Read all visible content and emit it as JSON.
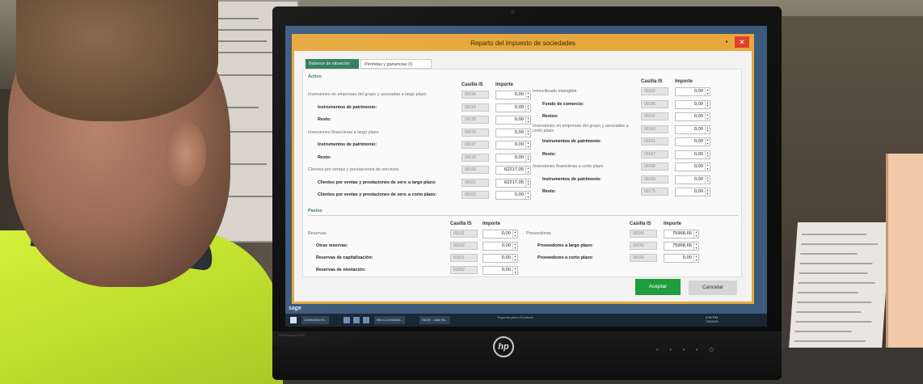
{
  "window": {
    "title": "Reparto del impuesto de sociedades",
    "close_glyph": "✕",
    "minimize_glyph": "▪"
  },
  "tabs": [
    {
      "label": "Balance de situación"
    },
    {
      "label": "Pérdidas y ganancias (I)"
    }
  ],
  "activo": {
    "section_title": "Activo",
    "header_casilla": "Casilla IS",
    "header_importe": "Importe",
    "left_rows": [
      {
        "label": "Inversiones en empresas del grupo y asociadas a largo plazo",
        "casilla": "00118",
        "importe": "0,00"
      },
      {
        "label": "Instrumentos de patrimonio:",
        "casilla": "00119",
        "importe": "0,00"
      },
      {
        "label": "Resto:",
        "casilla": "00125",
        "importe": "0,00"
      },
      {
        "label": "Inversiones financieras a largo plazo",
        "casilla": "00126",
        "importe": "0,00"
      },
      {
        "label": "Instrumentos de patrimonio:",
        "casilla": "00127",
        "importe": "0,00"
      },
      {
        "label": "Resto:",
        "casilla": "00133",
        "importe": "0,00"
      },
      {
        "label": "Clientes por ventas y prestaciones de servicios",
        "casilla": "00150",
        "importe": "62217,05"
      },
      {
        "label": "Clientes por ventas y prestaciones de serv. a largo plazo:",
        "casilla": "00151",
        "importe": "62217,05"
      },
      {
        "label": "Clientes por ventas y prestaciones de serv. a corto plazo:",
        "casilla": "00152",
        "importe": "0,00"
      }
    ],
    "right_rows": [
      {
        "label": "Inmovilizado intangible",
        "casilla": "00102",
        "importe": "0,00"
      },
      {
        "label": "Fondo de comercio:",
        "casilla": "00106",
        "importe": "0,00"
      },
      {
        "label": "Restos:",
        "casilla": "00110",
        "importe": "0,00"
      },
      {
        "label": "Inversiones en empresas del grupo y asociadas a corto plazo",
        "casilla": "00160",
        "importe": "0,00"
      },
      {
        "label": "Instrumentos de patrimonio:",
        "casilla": "00161",
        "importe": "0,00"
      },
      {
        "label": "Resto:",
        "casilla": "00167",
        "importe": "0,00"
      },
      {
        "label": "Inversiones financieras a corto plazo",
        "casilla": "00168",
        "importe": "0,00"
      },
      {
        "label": "Instrumentos de patrimonio:",
        "casilla": "00169",
        "importe": "0,00"
      },
      {
        "label": "Resto:",
        "casilla": "00175",
        "importe": "0,00"
      }
    ]
  },
  "pasivo": {
    "section_title": "Pasivo",
    "header_casilla": "Casilla IS",
    "header_importe": "Importe",
    "left_rows": [
      {
        "label": "Reservas",
        "casilla": "00191",
        "importe": "0,00"
      },
      {
        "label": "Otras reservas:",
        "casilla": "00192",
        "importe": "0,00"
      },
      {
        "label": "Reservas de capitalización:",
        "casilla": "01001",
        "importe": "0,00"
      },
      {
        "label": "Reservas de nivelación:",
        "casilla": "01002",
        "importe": "0,00"
      }
    ],
    "right_rows": [
      {
        "label": "Proveedores",
        "casilla": "00240",
        "importe": "75968,66"
      },
      {
        "label": "Proveedores a largo plazo:",
        "casilla": "00241",
        "importe": "75968,66"
      },
      {
        "label": "Proveedores a corto plazo:",
        "casilla": "00242",
        "importe": "0,00"
      }
    ]
  },
  "buttons": {
    "accept": "Aceptar",
    "cancel": "Cancelar"
  },
  "taskbar": {
    "brand": "sage",
    "items": [
      "Contenedor N...",
      "Micro-Contabilid...",
      "SAGE - sabe fis..."
    ],
    "center_text": "Segundo plano    Escritorio",
    "clock_time": "2:30 PM",
    "clock_date": "7/8/2019"
  },
  "monitor": {
    "brand": "hp",
    "model": "EliteDisplay E240i"
  },
  "icons": {
    "spin": "spinner-arrows-icon",
    "windows": "windows-start-icon"
  }
}
